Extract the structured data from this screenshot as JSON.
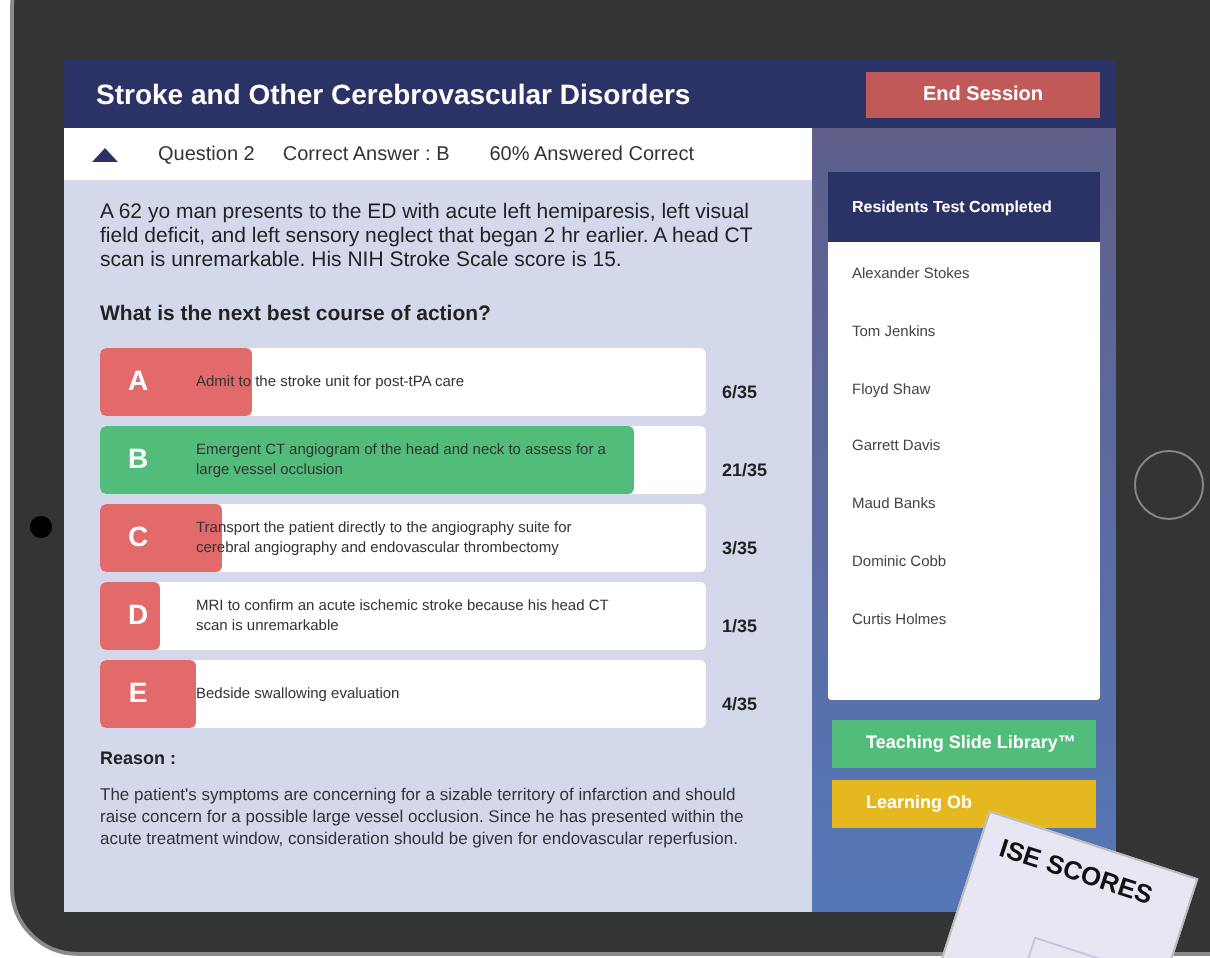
{
  "header": {
    "title": "Stroke and Other Cerebrovascular Disorders",
    "end_button": "End Session"
  },
  "question_bar": {
    "expanded": true,
    "question": "Question 2",
    "correct_answer": "Correct Answer : B",
    "percent_correct": "60% Answered Correct"
  },
  "stem": "A 62 yo man presents to the ED with acute left hemiparesis, left visual field deficit, and left sensory neglect that began 2 hr earlier. A head CT scan is unremarkable. His NIH Stroke Scale score is 15.",
  "prompt": "What is the next best course of action?",
  "options": [
    {
      "letter": "A",
      "text": "Admit to the stroke unit for post-tPA care",
      "count": "6/35",
      "correct": false,
      "level": 0.25
    },
    {
      "letter": "B",
      "text": "Emergent CT angiogram of the head and neck to assess for a large vessel occlusion",
      "count": "21/35",
      "correct": true,
      "level": 0.88
    },
    {
      "letter": "C",
      "text": "Transport the patient directly to the angiography suite for cerebral angiography and endovascular thrombectomy",
      "count": "3/35",
      "correct": false,
      "level": 0.2
    },
    {
      "letter": "D",
      "text": "MRI to confirm an acute ischemic stroke because his head CT scan is unremarkable",
      "count": "1/35",
      "correct": false,
      "level": 0.1
    },
    {
      "letter": "E",
      "text": "Bedside swallowing evaluation",
      "count": "4/35",
      "correct": false,
      "level": 0.16
    }
  ],
  "reason": {
    "label": "Reason :",
    "text": "The patient's symptoms are concerning for a sizable territory of infarction and should raise concern for a possible large vessel occlusion. Since he has presented within the acute treatment window, consideration should be given for endovascular reperfusion."
  },
  "residents": {
    "title": "Residents Test Completed",
    "names": [
      "Alexander Stokes",
      "Tom Jenkins",
      "Floyd Shaw",
      "Garrett Davis",
      "Maud Banks",
      "Dominic Cobb",
      "Curtis Holmes"
    ]
  },
  "buttons": [
    {
      "label": "Teaching Slide Library™",
      "kind": "green"
    },
    {
      "label": "Learning Ob",
      "kind": "yellow"
    }
  ],
  "paper": {
    "title": "ISE SCORES"
  }
}
